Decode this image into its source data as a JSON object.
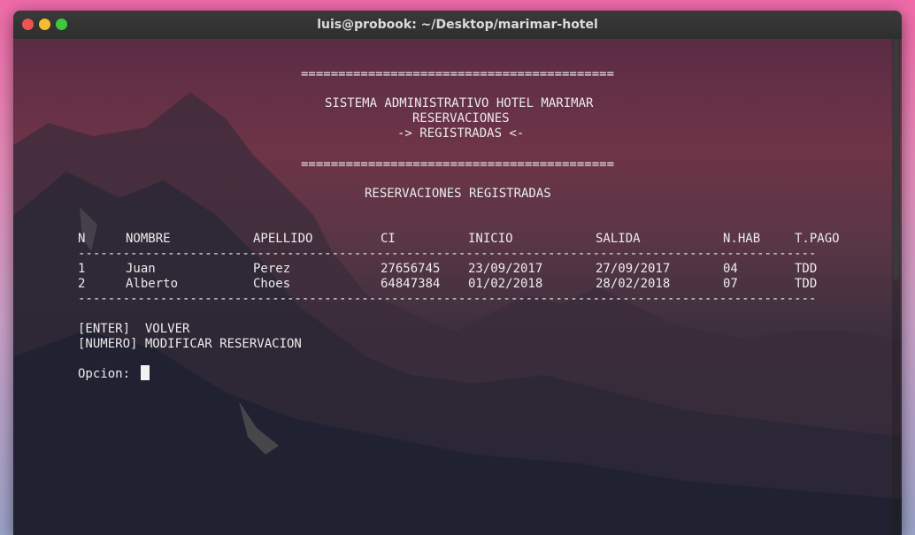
{
  "window": {
    "title": "luis@probook: ~/Desktop/marimar-hotel"
  },
  "header": {
    "rule": "==========================================",
    "system_title": "SISTEMA ADMINISTRATIVO HOTEL MARIMAR",
    "section": "RESERVACIONES",
    "subsection": "-> REGISTRADAS <-"
  },
  "table": {
    "title": "RESERVACIONES REGISTRADAS",
    "columns": [
      "N",
      "NOMBRE",
      "APELLIDO",
      "CI",
      "INICIO",
      "SALIDA",
      "N.HAB",
      "T.PAGO"
    ],
    "rule": "---------------------------------------------------------------------------------------------------",
    "rows": [
      [
        "1",
        "Juan",
        "Perez",
        "27656745",
        "23/09/2017",
        "27/09/2017",
        "04",
        "TDD"
      ],
      [
        "2",
        "Alberto",
        "Choes",
        "64847384",
        "01/02/2018",
        "28/02/2018",
        "07",
        "TDD"
      ]
    ]
  },
  "menu": {
    "enter": "[ENTER]  VOLVER",
    "numero": "[NUMERO] MODIFICAR RESERVACION",
    "prompt": "Opcion: "
  },
  "colors": {
    "close": "#ee5451",
    "minimize": "#f6bd2f",
    "maximize": "#3ec93c",
    "text": "#ececec"
  }
}
